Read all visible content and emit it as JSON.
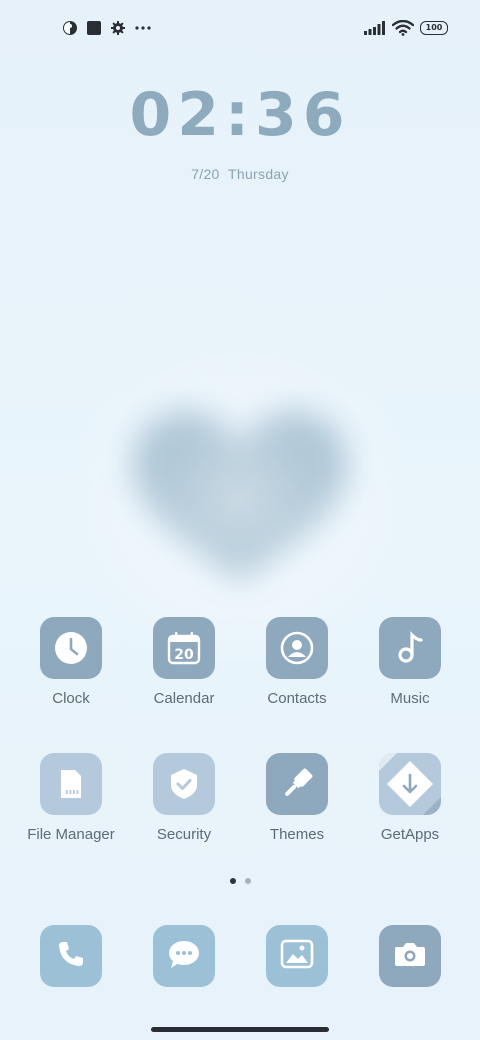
{
  "status_bar": {
    "left_icons": [
      "theme-icon",
      "square-notification-icon",
      "settings-gear-icon",
      "more-dots-icon"
    ],
    "right_icons": [
      "signal-bars-icon",
      "wifi-icon",
      "battery-icon"
    ],
    "battery_level": "100"
  },
  "clock_widget": {
    "time": "02:36",
    "date": "7/20",
    "weekday": "Thursday",
    "date_line": "7/20  Thursday"
  },
  "apps": [
    {
      "label": "Clock",
      "icon": "clock-icon"
    },
    {
      "label": "Calendar",
      "icon": "calendar-icon",
      "badge": "20"
    },
    {
      "label": "Contacts",
      "icon": "contacts-icon"
    },
    {
      "label": "Music",
      "icon": "music-note-icon"
    },
    {
      "label": "File Manager",
      "icon": "sd-card-icon"
    },
    {
      "label": "Security",
      "icon": "shield-check-icon"
    },
    {
      "label": "Themes",
      "icon": "paint-brush-icon"
    },
    {
      "label": "GetApps",
      "icon": "download-arrow-icon"
    }
  ],
  "page_indicator": {
    "pages": 2,
    "current": 1
  },
  "dock": [
    {
      "icon": "phone-icon"
    },
    {
      "icon": "messages-icon"
    },
    {
      "icon": "gallery-icon"
    },
    {
      "icon": "camera-icon"
    }
  ],
  "colors": {
    "background": "#e8f3fa",
    "clock_text": "#8eaabd",
    "icon_dark": "#8ea8bd",
    "icon_light": "#b4c9dc",
    "dock_icon": "#9cc0d5",
    "heart": "#8fb0c6"
  }
}
